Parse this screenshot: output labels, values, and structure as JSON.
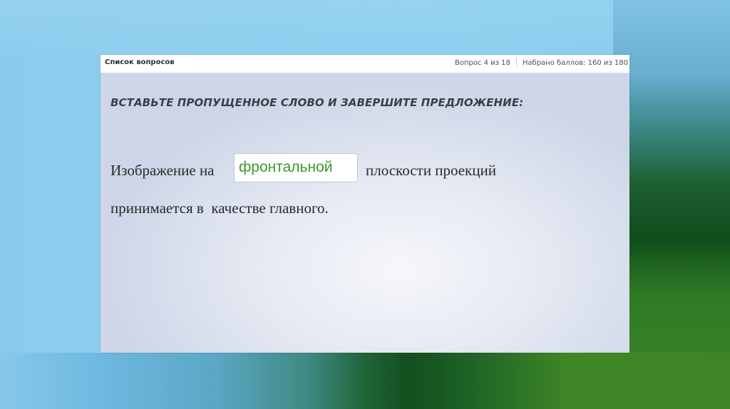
{
  "topbar": {
    "question_list_label": "Список вопросов",
    "question_progress": "Вопрос 4 из 18",
    "score": "Набрано баллов: 160 из 180"
  },
  "question": {
    "instruction": "ВСТАВЬТЕ ПРОПУЩЕННОЕ СЛОВО И ЗАВЕРШИТЕ ПРЕДЛОЖЕНИЕ:",
    "text_before": "Изображение на",
    "answer_value": "фронтальной",
    "text_after": "плоскости проекций",
    "text_line2": "принимается в  качестве главного."
  },
  "colors": {
    "answer_text": "#3d9a2e",
    "heading_text": "#3c3f44"
  }
}
